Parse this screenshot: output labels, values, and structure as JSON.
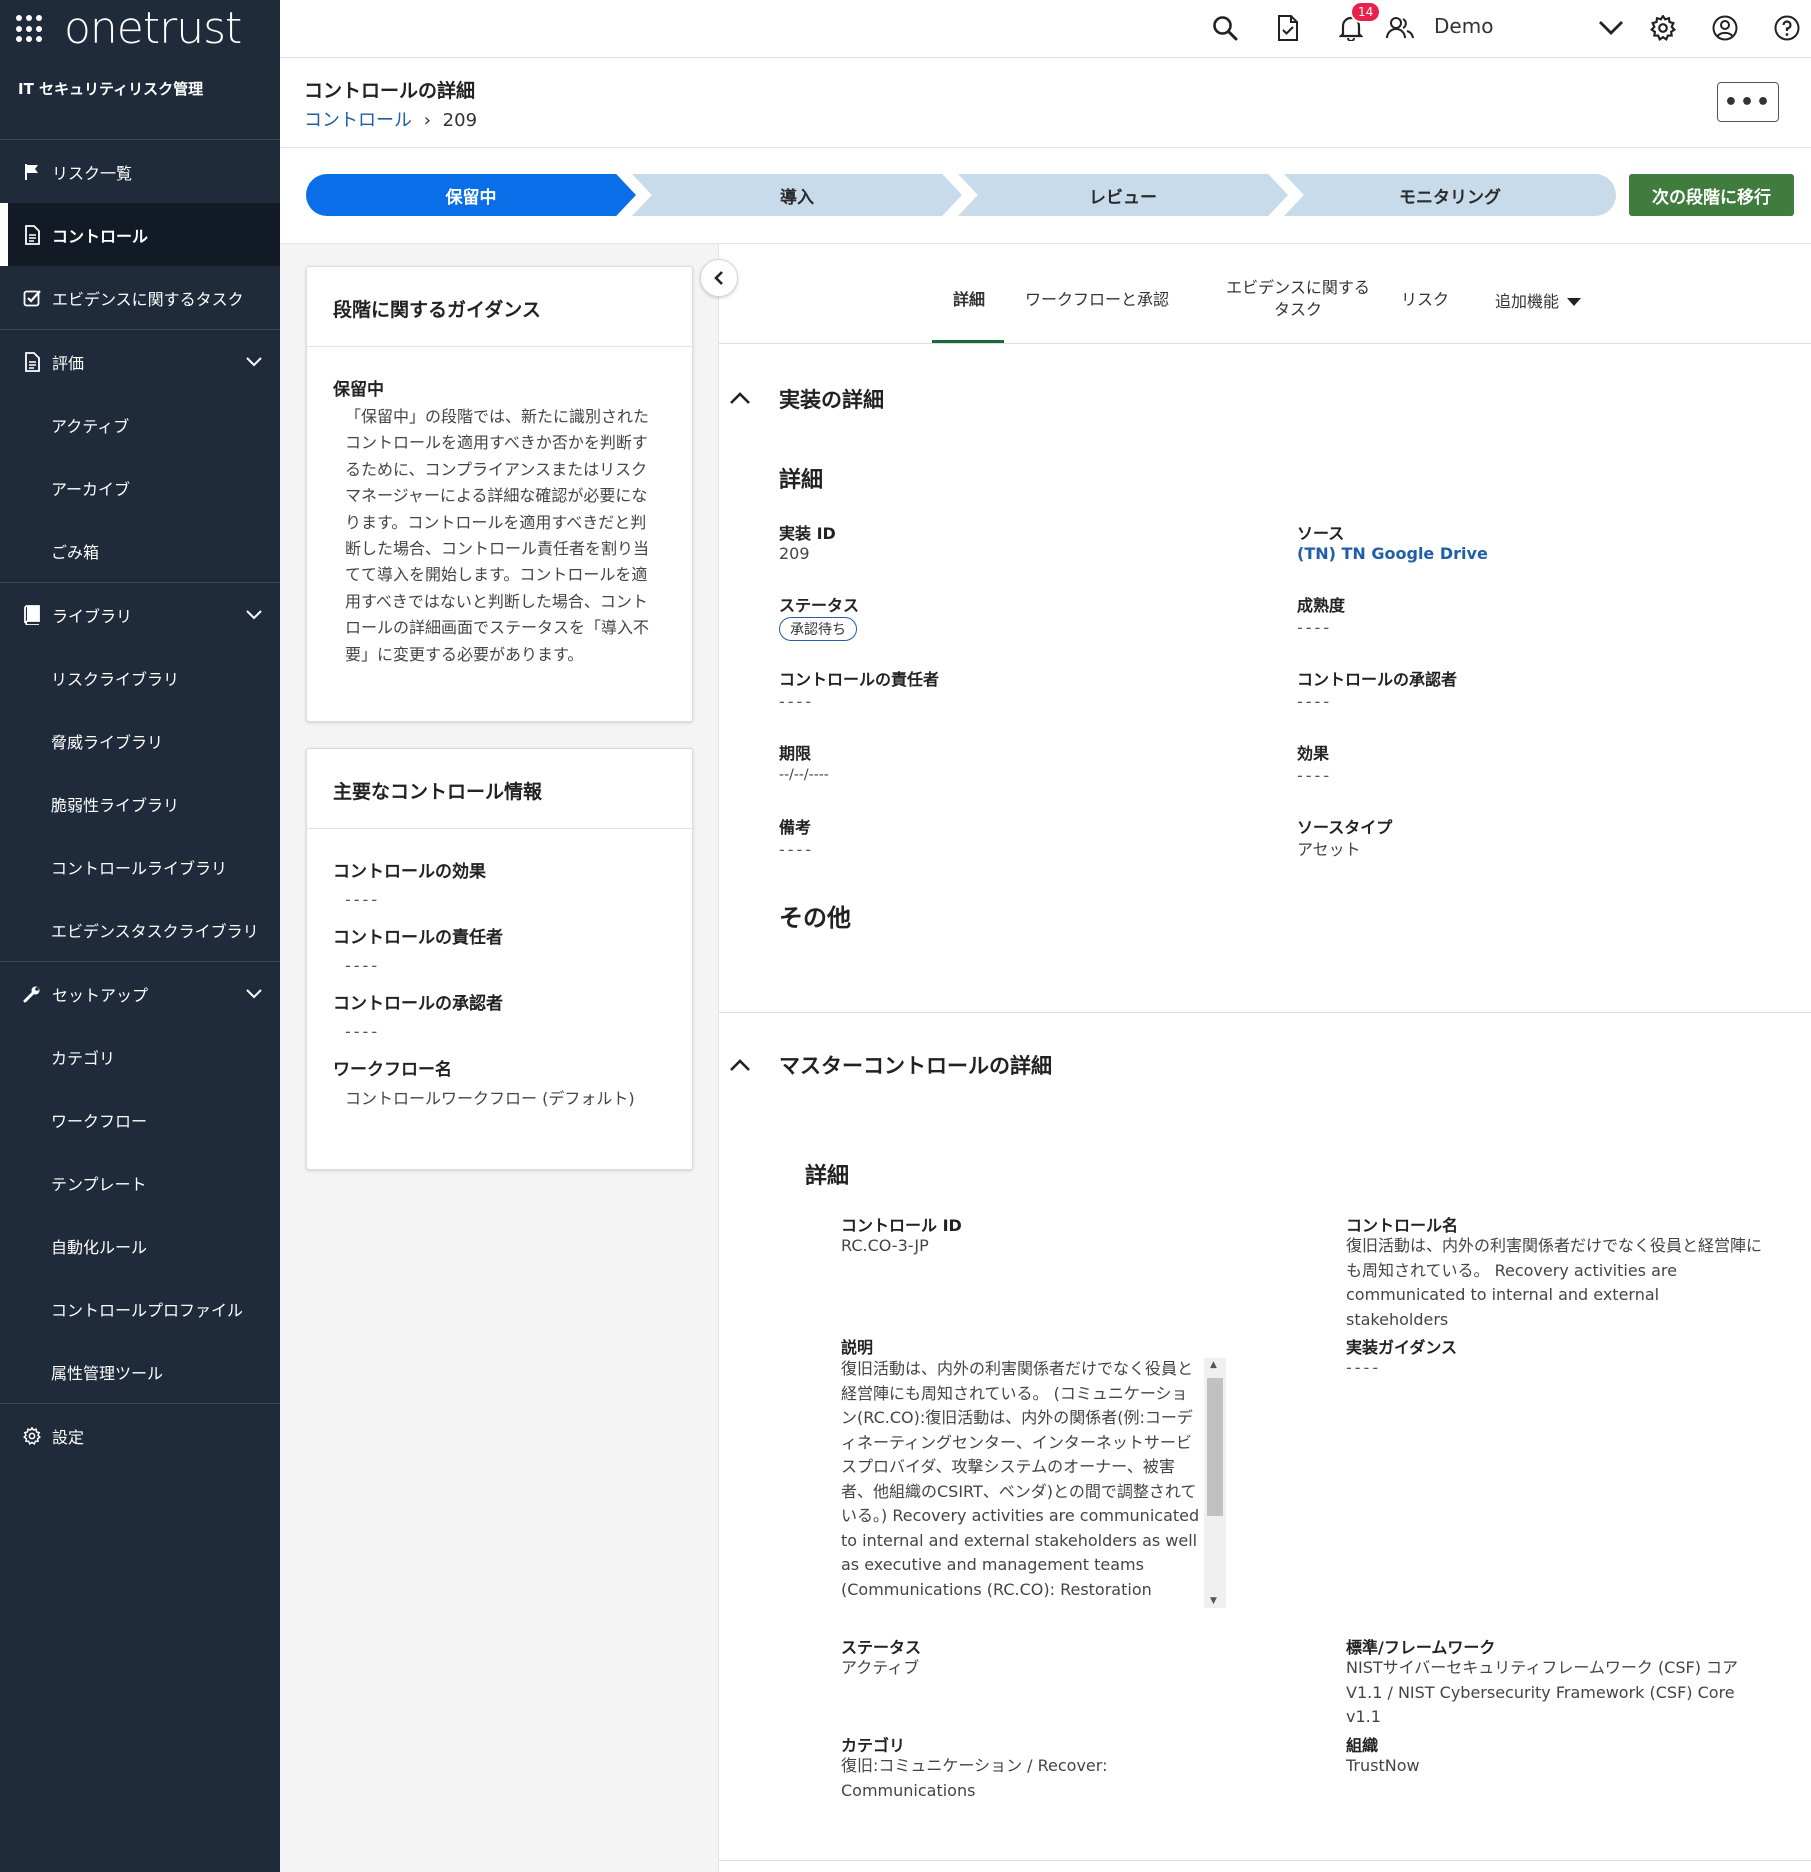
{
  "brand": {
    "name": "onetrust"
  },
  "sidebar": {
    "module_title": "IT セキュリティリスク管理",
    "items": [
      {
        "label": "リスク一覧",
        "icon": "flag-icon"
      },
      {
        "label": "コントロール",
        "icon": "document-icon",
        "active": true
      },
      {
        "label": "エビデンスに関するタスク",
        "icon": "checkbox-icon"
      },
      {
        "label": "評価",
        "icon": "document-icon",
        "expandable": true
      },
      {
        "label": "アクティブ"
      },
      {
        "label": "アーカイブ"
      },
      {
        "label": "ごみ箱"
      },
      {
        "label": "ライブラリ",
        "icon": "book-icon",
        "expandable": true
      },
      {
        "label": "リスクライブラリ"
      },
      {
        "label": "脅威ライブラリ"
      },
      {
        "label": "脆弱性ライブラリ"
      },
      {
        "label": "コントロールライブラリ"
      },
      {
        "label": "エビデンスタスクライブラリ"
      },
      {
        "label": "セットアップ",
        "icon": "wrench-icon",
        "expandable": true
      },
      {
        "label": "カテゴリ"
      },
      {
        "label": "ワークフロー"
      },
      {
        "label": "テンプレート"
      },
      {
        "label": "自動化ルール"
      },
      {
        "label": "コントロールプロファイル"
      },
      {
        "label": "属性管理ツール"
      },
      {
        "label": "設定",
        "icon": "gear-icon"
      }
    ]
  },
  "topbar": {
    "notification_count": "14",
    "user_name": "Demo"
  },
  "header": {
    "title": "コントロールの詳細",
    "breadcrumb_link": "コントロール",
    "breadcrumb_sep": "›",
    "breadcrumb_current": "209",
    "more_label": "•••"
  },
  "stages": {
    "items": [
      "保留中",
      "導入",
      "レビュー",
      "モニタリング"
    ],
    "current": "保留中",
    "next_button": "次の段階に移行"
  },
  "guidance": {
    "title": "段階に関するガイダンス",
    "stage_label": "保留中",
    "text": "「保留中」の段階では、新たに識別されたコントロールを適用すべきか否かを判断するために、コンプライアンスまたはリスクマネージャーによる詳細な確認が必要になります。コントロールを適用すべきだと判断した場合、コントロール責任者を割り当てて導入を開始します。コントロールを適用すべきではないと判断した場合、コントロールの詳細画面でステータスを「導入不要」に変更する必要があります。"
  },
  "key_info": {
    "title": "主要なコントロール情報",
    "effect_label": "コントロールの効果",
    "effect_value": "----",
    "owner_label": "コントロールの責任者",
    "owner_value": "----",
    "approver_label": "コントロールの承認者",
    "approver_value": "----",
    "workflow_label": "ワークフロー名",
    "workflow_value": "コントロールワークフロー (デフォルト)"
  },
  "tabs": {
    "details": "詳細",
    "workflow": "ワークフローと承認",
    "evidence_line1": "エビデンスに関する",
    "evidence_line2": "タスク",
    "risk": "リスク",
    "more": "追加機能"
  },
  "impl": {
    "section_title": "実装の詳細",
    "sub_title": "詳細",
    "id_label": "実装 ID",
    "id_value": "209",
    "source_label": "ソース",
    "source_value": "(TN) TN Google Drive",
    "status_label": "ステータス",
    "status_value": "承認待ち",
    "maturity_label": "成熟度",
    "maturity_value": "----",
    "owner_label": "コントロールの責任者",
    "owner_value": "----",
    "approver_label": "コントロールの承認者",
    "approver_value": "----",
    "deadline_label": "期限",
    "deadline_value": "--/--/----",
    "effect_label": "効果",
    "effect_value": "----",
    "notes_label": "備考",
    "notes_value": "----",
    "source_type_label": "ソースタイプ",
    "source_type_value": "アセット",
    "other_title": "その他"
  },
  "master": {
    "section_title": "マスターコントロールの詳細",
    "sub_title": "詳細",
    "id_label": "コントロール ID",
    "id_value": "RC.CO-3-JP",
    "name_label": "コントロール名",
    "name_value": "復旧活動は、内外の利害関係者だけでなく役員と経営陣にも周知されている。 Recovery activities are communicated to internal and external stakeholders",
    "desc_label": "説明",
    "desc_value": "復旧活動は、内外の利害関係者だけでなく役員と経営陣にも周知されている。 (コミュニケーション(RC.CO):復旧活動は、内外の関係者(例:コーディネーティングセンター、インターネットサービスプロバイダ、攻撃システムのオーナー、被害者、他組織のCSIRT、ベンダ)との間で調整されている。) Recovery activities are communicated to internal and external stakeholders as well as executive and management teams (Communications (RC.CO): Restoration activities are coordinated with internal and external parties",
    "guidance_label": "実装ガイダンス",
    "guidance_value": "----",
    "status_label": "ステータス",
    "status_value": "アクティブ",
    "framework_label": "標準/フレームワーク",
    "framework_value": "NISTサイバーセキュリティフレームワーク (CSF) コア V1.1 / NIST Cybersecurity Framework (CSF) Core v1.1",
    "category_label": "カテゴリ",
    "category_value": "復旧:コミュニケーション / Recover: Communications",
    "org_label": "組織",
    "org_value": "TrustNow"
  },
  "colors": {
    "sidebar": "#1f2a3a",
    "accent": "#0a6ee9",
    "next_button": "#3f7c3e",
    "link": "#1f5ea8",
    "badge": "#e8214a"
  }
}
